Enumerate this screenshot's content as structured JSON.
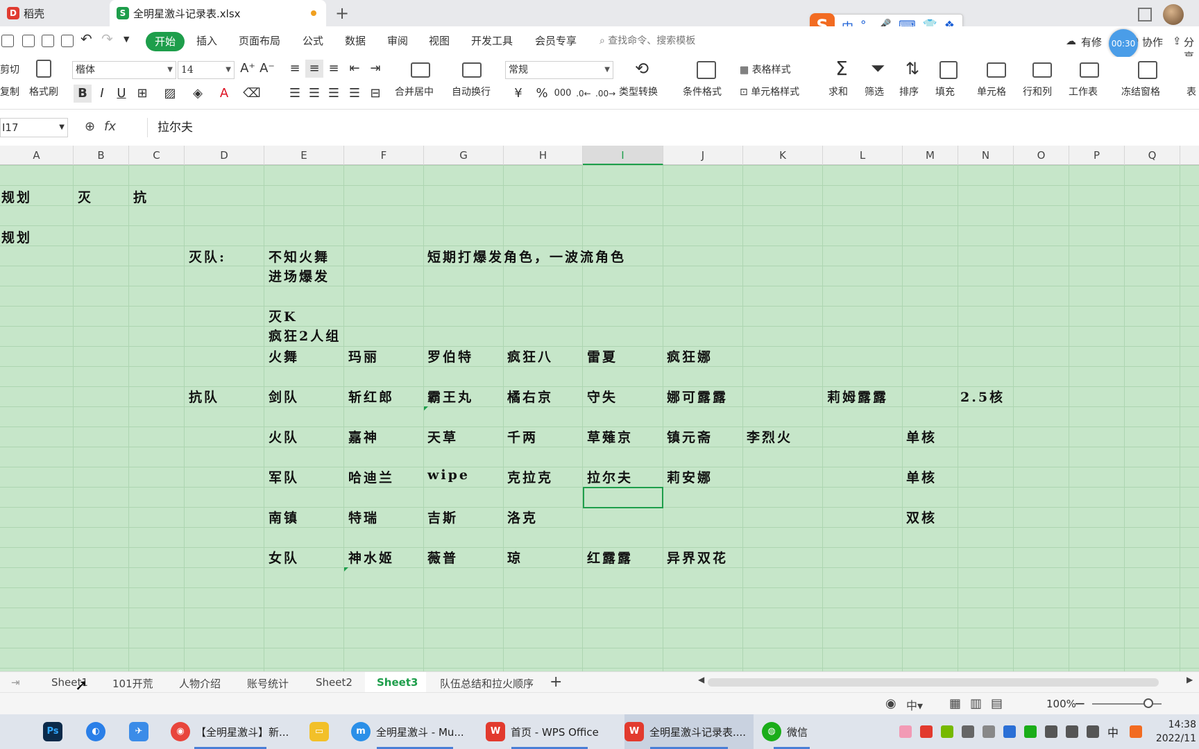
{
  "tabs": {
    "tab1_label": "稻壳",
    "tab2_label": "全明星激斗记录表.xlsx",
    "add_tab": "+"
  },
  "ime": {
    "lang": "中",
    "punct": "°,"
  },
  "menu": {
    "items": [
      "开始",
      "插入",
      "页面布局",
      "公式",
      "数据",
      "审阅",
      "视图",
      "开发工具",
      "会员专享"
    ],
    "search_placeholder": "查找命令、搜索模板",
    "edit_status": "有修",
    "collab": "协作",
    "share": "分享",
    "timer": "00:30"
  },
  "ribbon": {
    "cut": "剪切",
    "copy": "复制",
    "format_painter": "格式刷",
    "font_name": "楷体",
    "font_size": "14",
    "merge_center": "合并居中",
    "auto_wrap": "自动换行",
    "number_format": "常规",
    "type_convert": "类型转换",
    "cond_format": "条件格式",
    "table_style": "表格样式",
    "cell_style": "单元格样式",
    "sum": "求和",
    "filter": "筛选",
    "sort": "排序",
    "fill": "填充",
    "cell": "单元格",
    "row_col": "行和列",
    "worksheet": "工作表",
    "freeze": "冻结窗格",
    "table_tools": "表"
  },
  "formula_bar": {
    "name_box": "I17",
    "fx": "fx",
    "content": "拉尔夫"
  },
  "columns": [
    "A",
    "B",
    "C",
    "D",
    "E",
    "F",
    "G",
    "H",
    "I",
    "J",
    "K",
    "L",
    "M",
    "N",
    "O",
    "P",
    "Q"
  ],
  "cells": {
    "r3_a": "规划",
    "r3_b": "灭",
    "r3_c": "抗",
    "r5_a": "规划",
    "r6_d": "灭队:",
    "r6_e": "不知火舞",
    "r6_g": "短期打爆发角色，一波流角色",
    "r7_e": "进场爆发",
    "r9_e": "灭K",
    "r10_e": "疯狂2人组",
    "r11_e": "火舞",
    "r11_f": "玛丽",
    "r11_g": "罗伯特",
    "r11_h": "疯狂八",
    "r11_i": "雷夏",
    "r11_j": "疯狂娜",
    "r13_d": "抗队",
    "r13_e": "剑队",
    "r13_f": "斩红郎",
    "r13_g": "霸王丸",
    "r13_h": "橘右京",
    "r13_i": "守失",
    "r13_j": "娜可露露",
    "r13_l": "莉姆露露",
    "r13_n": "2.5核",
    "r15_e": "火队",
    "r15_f": "嘉神",
    "r15_g": "天草",
    "r15_h": "千两",
    "r15_i": "草薙京",
    "r15_j": "镇元斋",
    "r15_k": "李烈火",
    "r15_m": "单核",
    "r17_e": "军队",
    "r17_f": "哈迪兰",
    "r17_g": "wipe",
    "r17_h": "克拉克",
    "r17_i": "拉尔夫",
    "r17_j": "莉安娜",
    "r17_m": "单核",
    "r19_e": "南镇",
    "r19_f": "特瑞",
    "r19_g": "吉斯",
    "r19_h": "洛克",
    "r19_m": "双核",
    "r21_e": "女队",
    "r21_f": "神水姬",
    "r21_g": "薇普",
    "r21_h": "琼",
    "r21_i": "红露露",
    "r21_j": "异界双花"
  },
  "sheet_tabs": [
    "Sheet1",
    "101开荒",
    "人物介绍",
    "账号统计",
    "Sheet2",
    "Sheet3",
    "队伍总结和拉火顺序"
  ],
  "active_sheet": "Sheet3",
  "status": {
    "zoom": "100%"
  },
  "taskbar": {
    "chrome": "【全明星激斗】新...",
    "mu": "全明星激斗 - Mu...",
    "wps_home": "首页 - WPS Office",
    "wps_doc": "全明星激斗记录表....",
    "wechat": "微信",
    "ime_mode": "中",
    "time": "14:38",
    "date": "2022/11"
  }
}
